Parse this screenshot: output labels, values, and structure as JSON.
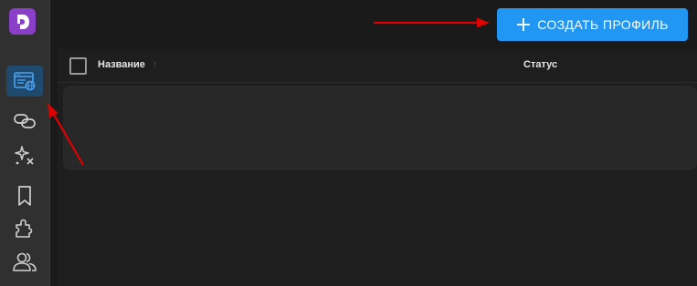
{
  "sidebar": {
    "logo_letter": "D",
    "items": [
      {
        "icon": "browser-profiles-icon",
        "active": true
      },
      {
        "icon": "link-proxy-icon",
        "active": false
      },
      {
        "icon": "sparkle-automation-icon",
        "active": false
      },
      {
        "icon": "bookmark-icon",
        "active": false
      },
      {
        "icon": "extension-puzzle-icon",
        "active": false
      },
      {
        "icon": "team-users-icon",
        "active": false
      }
    ]
  },
  "header": {
    "create_button_label": "СОЗДАТЬ ПРОФИЛЬ"
  },
  "table": {
    "columns": [
      "Название",
      "Статус"
    ],
    "rows": []
  },
  "colors": {
    "accent": "#2196f3",
    "logo": "#8a3fc9",
    "annotation_arrow": "#e00000"
  }
}
